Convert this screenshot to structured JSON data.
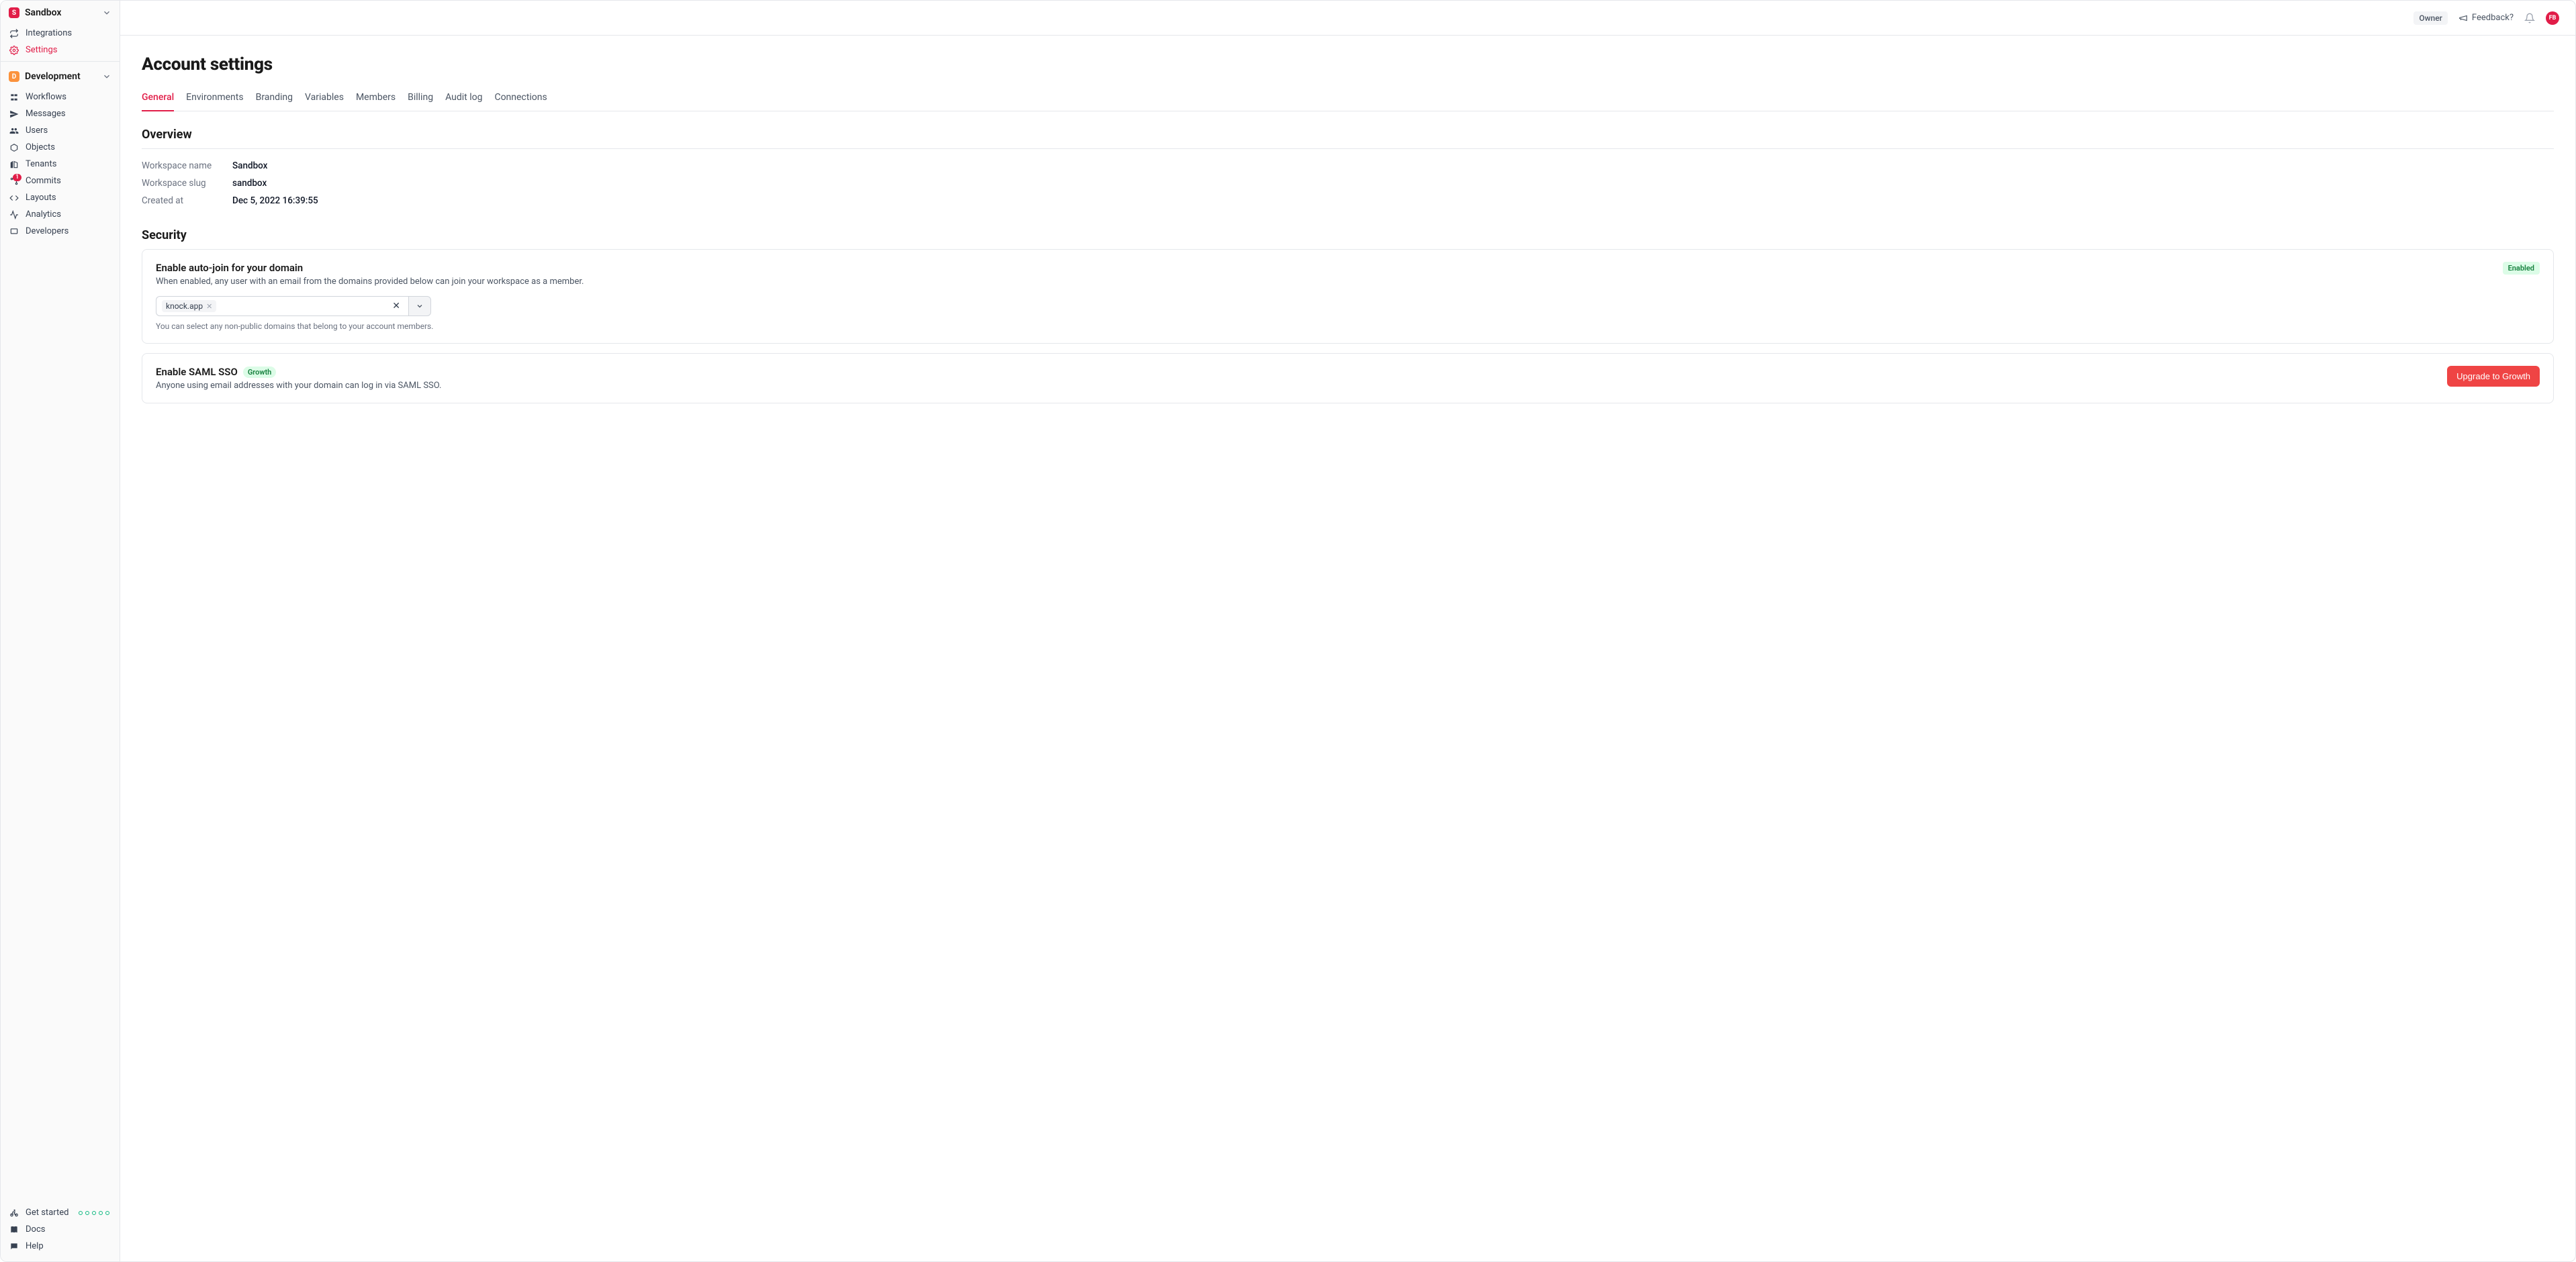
{
  "sidebar": {
    "workspace": {
      "initial": "S",
      "name": "Sandbox"
    },
    "top_items": [
      {
        "label": "Integrations"
      },
      {
        "label": "Settings"
      }
    ],
    "env": {
      "initial": "D",
      "name": "Development"
    },
    "nav_items": [
      {
        "label": "Workflows"
      },
      {
        "label": "Messages"
      },
      {
        "label": "Users"
      },
      {
        "label": "Objects"
      },
      {
        "label": "Tenants"
      },
      {
        "label": "Commits",
        "badge": "1"
      },
      {
        "label": "Layouts"
      },
      {
        "label": "Analytics"
      },
      {
        "label": "Developers"
      }
    ],
    "footer": {
      "get_started": "Get started",
      "docs": "Docs",
      "help": "Help"
    }
  },
  "topbar": {
    "owner_badge": "Owner",
    "feedback": "Feedback?",
    "avatar_initials": "FB"
  },
  "page": {
    "title": "Account settings",
    "tabs": [
      "General",
      "Environments",
      "Branding",
      "Variables",
      "Members",
      "Billing",
      "Audit log",
      "Connections"
    ],
    "active_tab": 0,
    "overview": {
      "heading": "Overview",
      "rows": [
        {
          "label": "Workspace name",
          "value": "Sandbox"
        },
        {
          "label": "Workspace slug",
          "value": "sandbox"
        },
        {
          "label": "Created at",
          "value": "Dec 5, 2022 16:39:55"
        }
      ]
    },
    "security": {
      "heading": "Security",
      "autojoin": {
        "title": "Enable auto-join for your domain",
        "desc": "When enabled, any user with an email from the domains provided below can join your workspace as a member.",
        "status": "Enabled",
        "chip": "knock.app",
        "helper": "You can select any non-public domains that belong to your account members."
      },
      "sso": {
        "title": "Enable SAML SSO",
        "plan_badge": "Growth",
        "desc": "Anyone using email addresses with your domain can log in via SAML SSO.",
        "cta": "Upgrade to Growth"
      }
    }
  }
}
